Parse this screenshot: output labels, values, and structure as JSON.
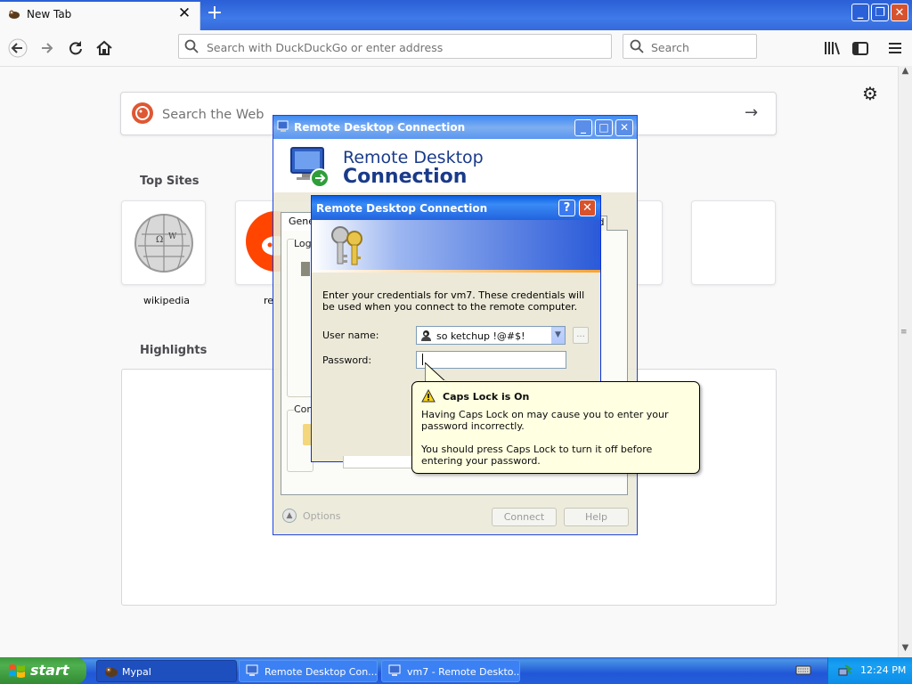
{
  "browser": {
    "tab_title": "New Tab",
    "new_tab_symbol": "+",
    "url_placeholder": "Search with DuckDuckGo or enter address",
    "search_placeholder": "Search",
    "icons": [
      "back-icon",
      "forward-icon",
      "reload-icon",
      "home-icon",
      "library-icon",
      "sidebar-icon",
      "menu-icon",
      "gear-icon"
    ]
  },
  "newtab": {
    "web_search_placeholder": "Search the Web",
    "top_sites_title": "Top Sites",
    "top_sites": [
      {
        "label": "wikipedia"
      },
      {
        "label": "re"
      }
    ],
    "highlights_title": "Highlights"
  },
  "rdc_window": {
    "title": "Remote Desktop Connection",
    "banner_line1": "Remote Desktop",
    "banner_line2": "Connection",
    "tab_general": "Gene",
    "tab_d": "d",
    "group1_label": "Log",
    "group2_label": "Con",
    "options_label": "Options",
    "connect_label": "Connect",
    "help_label": "Help"
  },
  "credentials_dialog": {
    "title": "Remote Desktop Connection",
    "help_symbol": "?",
    "close_symbol": "✕",
    "instructions": "Enter your credentials for vm7. These credentials will be used when you connect to the remote computer.",
    "username_label": "User name:",
    "username_value": "so ketchup !@#$!",
    "password_label": "Password:",
    "more_symbol": "..."
  },
  "caps_tooltip": {
    "title": "Caps Lock is On",
    "body1": "Having Caps Lock on may cause you to enter your password incorrectly.",
    "body2": "You should press Caps Lock to turn it off before entering your password."
  },
  "taskbar": {
    "start_label": "start",
    "items": [
      {
        "label": "Mypal"
      },
      {
        "label": "Remote Desktop Con..."
      },
      {
        "label": "vm7 - Remote Deskto..."
      }
    ],
    "clock": "12:24 PM"
  }
}
